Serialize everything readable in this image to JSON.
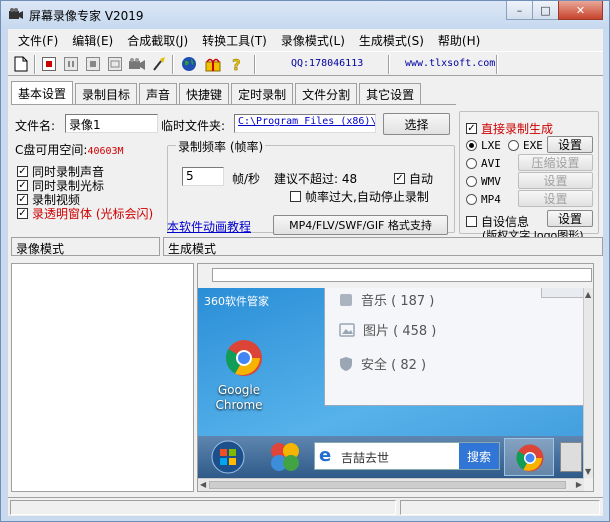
{
  "window": {
    "title": "屏幕录像专家 V2019"
  },
  "menu": [
    "文件(F)",
    "编辑(E)",
    "合成截取(J)",
    "转换工具(T)",
    "录像模式(L)",
    "生成模式(S)",
    "帮助(H)"
  ],
  "toolbar": {
    "qq": "QQ:178046113",
    "website": "www.tlxsoft.com"
  },
  "tabs": [
    "基本设置",
    "录制目标",
    "声音",
    "快捷键",
    "定时录制",
    "文件分割",
    "其它设置"
  ],
  "basic": {
    "filename_label": "文件名:",
    "filename_value": "录像1",
    "tempdir_label": "临时文件夹:",
    "tempdir_value": "C:\\Program Files (x86)\\",
    "select_button": "选择",
    "disk_label": "C盘可用空间:",
    "disk_value": "40603M",
    "checks": [
      {
        "label": "同时录制声音",
        "checked": true,
        "red": false
      },
      {
        "label": "同时录制光标",
        "checked": true,
        "red": false
      },
      {
        "label": "录制视频",
        "checked": true,
        "red": false
      },
      {
        "label": "录透明窗体 (光标会闪)",
        "checked": true,
        "red": true
      }
    ],
    "fps_group": "录制频率 (帧率)",
    "fps_value": "5",
    "fps_unit": "帧/秒",
    "fps_max": "建议不超过: 48",
    "auto_label": "自动",
    "auto_stop_label": "帧率过大,自动停止录制",
    "tutorial_link": "本软件动画教程",
    "format_button": "MP4/FLV/SWF/GIF 格式支持"
  },
  "direct": {
    "title": "直接录制生成",
    "formats": [
      {
        "label": "LXE",
        "selected": true
      },
      {
        "label": "AVI",
        "selected": false
      },
      {
        "label": "WMV",
        "selected": false
      },
      {
        "label": "MP4",
        "selected": false
      }
    ],
    "exe_label": "EXE",
    "settings": "设置",
    "compress_settings": "压缩设置",
    "custom_info": "自设信息",
    "custom_settings": "设置",
    "note": "(版权文字 logo图形)"
  },
  "sections": {
    "record_mode": "录像模式",
    "gen_mode": "生成模式"
  },
  "preview": {
    "security_tool": "360软件管家",
    "music": "音乐 ( 187 )",
    "pictures": "图片 ( 458 )",
    "security": "安全 ( 82 )",
    "desktop_icon": "Google Chrome",
    "search_text": "吉喆去世",
    "search_button": "搜索"
  },
  "colors": {
    "accent_red": "#d00000",
    "link_blue": "#0000cc",
    "disk_red": "#d00000"
  }
}
